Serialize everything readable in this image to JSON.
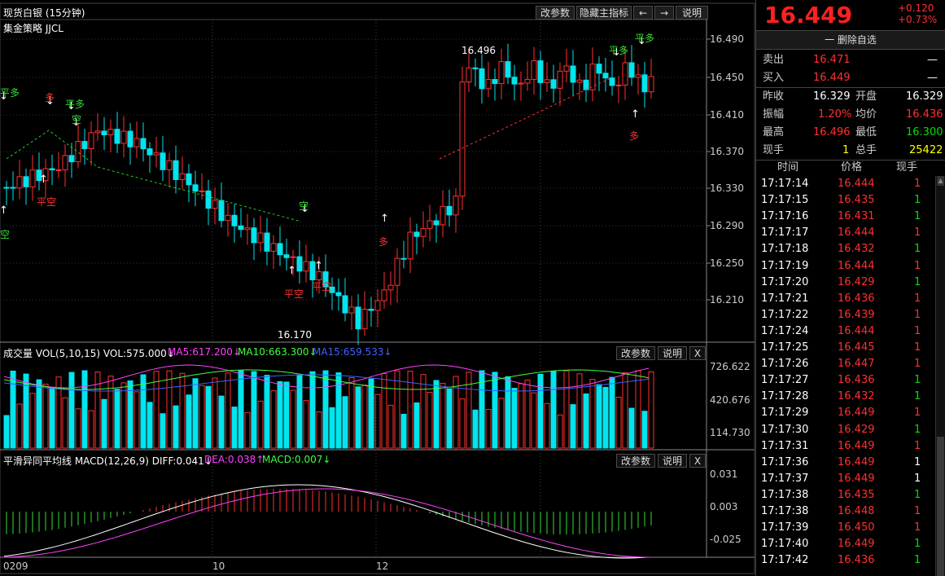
{
  "header": {
    "title": "现货白银 (15分钟)",
    "strategy": "集金策略 JJCL",
    "buttons": [
      "改参数",
      "隐藏主指标",
      "←",
      "→",
      "说明"
    ]
  },
  "price_axis": [
    "16.490",
    "16.450",
    "16.410",
    "16.370",
    "16.330",
    "16.290",
    "16.250",
    "16.210"
  ],
  "annotations": {
    "high_label": "16.496",
    "low_label": "16.170",
    "signals": [
      "平多",
      "多",
      "平多",
      "空",
      "平空",
      "空",
      "平空",
      "平空",
      "多",
      "平多",
      "平多",
      "多"
    ]
  },
  "volume_panel": {
    "title": "成交量 VOL(5,10,15) VOL:575.000↓",
    "ma5": "MA5:617.200↓",
    "ma10": "MA10:663.300↓",
    "ma15": "MA15:659.533↓",
    "axis": [
      "726.622",
      "420.676",
      "114.730"
    ],
    "buttons": [
      "改参数",
      "说明",
      "X"
    ]
  },
  "macd_panel": {
    "title": "平滑异同平均线 MACD(12,26,9) DIFF:0.041↓",
    "dea": "DEA:0.038↑",
    "macd": "MACD:0.007↓",
    "axis": [
      "0.031",
      "0.003",
      "-0.025"
    ],
    "buttons": [
      "改参数",
      "说明",
      "X"
    ]
  },
  "time_axis": [
    "0209",
    "10",
    "12"
  ],
  "quote": {
    "price": "16.449",
    "arrow": "⬆",
    "change": "+0.120",
    "change_pct": "+0.73%",
    "delete_fav": "一 删除自选",
    "sell_label": "卖出",
    "sell_price": "16.471",
    "sell_vol": "—",
    "buy_label": "买入",
    "buy_price": "16.449",
    "buy_vol": "—",
    "rows": [
      {
        "l1": "昨收",
        "v1": "16.329",
        "l2": "开盘",
        "v2": "16.329"
      },
      {
        "l1": "振幅",
        "v1": "1.20%",
        "l2": "均价",
        "v2": "16.436"
      },
      {
        "l1": "最高",
        "v1": "16.496",
        "l2": "最低",
        "v2": "16.300"
      },
      {
        "l1": "现手",
        "v1": "1",
        "l2": "总手",
        "v2": "25422"
      }
    ],
    "tick_headers": [
      "时间",
      "价格",
      "现手"
    ],
    "ticks": [
      {
        "t": "17:17:14",
        "p": "16.444",
        "v": "1",
        "c": "red"
      },
      {
        "t": "17:17:15",
        "p": "16.435",
        "v": "1",
        "c": "green"
      },
      {
        "t": "17:17:16",
        "p": "16.431",
        "v": "1",
        "c": "green"
      },
      {
        "t": "17:17:17",
        "p": "16.444",
        "v": "1",
        "c": "red"
      },
      {
        "t": "17:17:18",
        "p": "16.432",
        "v": "1",
        "c": "green"
      },
      {
        "t": "17:17:19",
        "p": "16.444",
        "v": "1",
        "c": "red"
      },
      {
        "t": "17:17:20",
        "p": "16.429",
        "v": "1",
        "c": "green"
      },
      {
        "t": "17:17:21",
        "p": "16.436",
        "v": "1",
        "c": "red"
      },
      {
        "t": "17:17:22",
        "p": "16.439",
        "v": "1",
        "c": "red"
      },
      {
        "t": "17:17:24",
        "p": "16.444",
        "v": "1",
        "c": "red"
      },
      {
        "t": "17:17:25",
        "p": "16.445",
        "v": "1",
        "c": "red"
      },
      {
        "t": "17:17:26",
        "p": "16.447",
        "v": "1",
        "c": "red"
      },
      {
        "t": "17:17:27",
        "p": "16.436",
        "v": "1",
        "c": "green"
      },
      {
        "t": "17:17:28",
        "p": "16.432",
        "v": "1",
        "c": "green"
      },
      {
        "t": "17:17:29",
        "p": "16.449",
        "v": "1",
        "c": "red"
      },
      {
        "t": "17:17:30",
        "p": "16.429",
        "v": "1",
        "c": "green"
      },
      {
        "t": "17:17:31",
        "p": "16.449",
        "v": "1",
        "c": "red"
      },
      {
        "t": "17:17:36",
        "p": "16.449",
        "v": "1",
        "c": "white"
      },
      {
        "t": "17:17:37",
        "p": "16.449",
        "v": "1",
        "c": "white"
      },
      {
        "t": "17:17:38",
        "p": "16.435",
        "v": "1",
        "c": "green"
      },
      {
        "t": "17:17:38",
        "p": "16.448",
        "v": "1",
        "c": "red"
      },
      {
        "t": "17:17:39",
        "p": "16.450",
        "v": "1",
        "c": "red"
      },
      {
        "t": "17:17:40",
        "p": "16.449",
        "v": "1",
        "c": "green"
      },
      {
        "t": "17:17:42",
        "p": "16.436",
        "v": "1",
        "c": "green"
      }
    ]
  }
}
